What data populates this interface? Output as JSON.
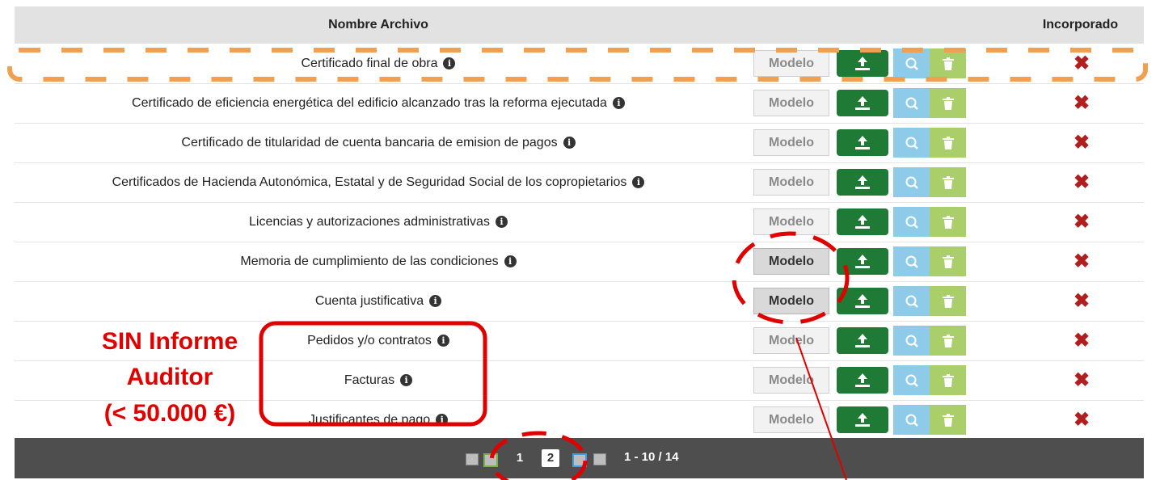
{
  "header": {
    "name": "Nombre Archivo",
    "incorporated": "Incorporado"
  },
  "button_label": "Modelo",
  "cross_symbol": "✖",
  "info_symbol": "i",
  "rows": [
    {
      "name": "Certificado final de obra"
    },
    {
      "name": "Certificado de eficiencia energética del edificio alcanzado tras la reforma ejecutada"
    },
    {
      "name": "Certificado de titularidad de cuenta bancaria de emision de pagos"
    },
    {
      "name": "Certificados de Hacienda Autonómica, Estatal y de Seguridad Social de los copropietarios"
    },
    {
      "name": "Licencias y autorizaciones administrativas"
    },
    {
      "name": "Memoria de cumplimiento de las condiciones"
    },
    {
      "name": "Cuenta justificativa"
    },
    {
      "name": "Pedidos y/o contratos"
    },
    {
      "name": "Facturas"
    },
    {
      "name": "Justificantes de pago"
    }
  ],
  "pagination": {
    "page1": "1",
    "page2": "2",
    "range": "1 - 10 / 14"
  },
  "annotation": {
    "line1": "SIN Informe",
    "line2": "Auditor",
    "line3": "(< 50.000 €)"
  },
  "colors": {
    "upload": "#1e7a35",
    "search": "#8dcbe8",
    "delete": "#a9ce6a",
    "cross": "#b01e1e",
    "annotation": "#e00000",
    "highlight": "#f0a050"
  }
}
